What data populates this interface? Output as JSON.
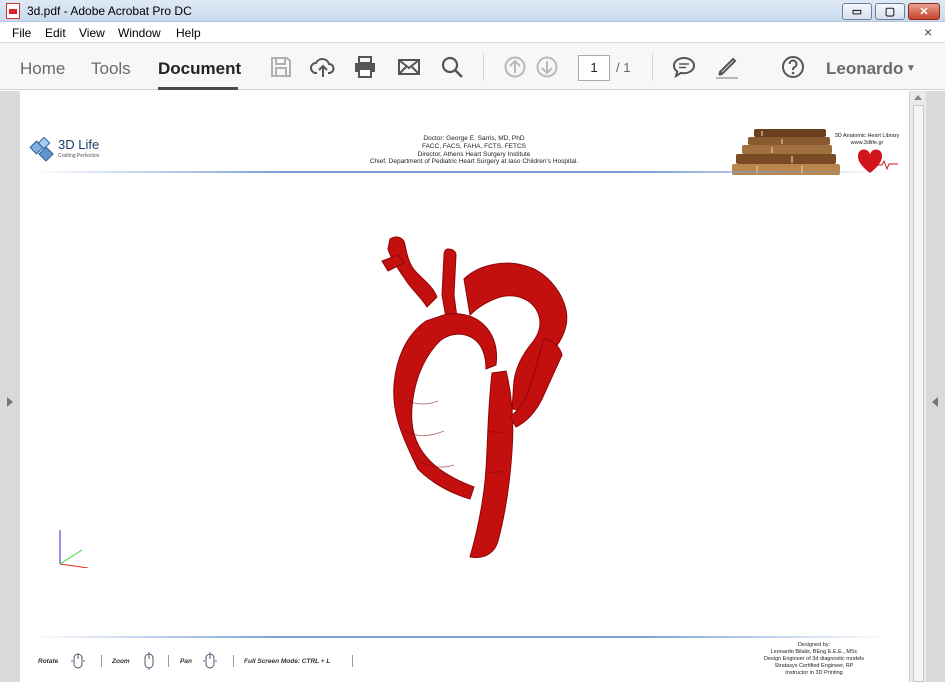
{
  "window": {
    "title": "3d.pdf - Adobe Acrobat Pro DC",
    "controls": {
      "minimize": "▭",
      "maximize": "▢",
      "close": "✕"
    }
  },
  "menu": {
    "items": [
      "File",
      "Edit",
      "View",
      "Window",
      "Help"
    ],
    "close_doc": "×"
  },
  "toolbar": {
    "tabs": [
      "Home",
      "Tools",
      "Document"
    ],
    "active_tab": "Document",
    "icons": [
      "save-icon",
      "upload-cloud-icon",
      "print-icon",
      "email-icon",
      "search-icon",
      "page-up-icon",
      "page-down-icon",
      "comment-icon",
      "highlight-pen-icon",
      "help-icon"
    ],
    "current_page": "1",
    "total_pages": "/ 1",
    "user": "Leonardo",
    "user_caret": "▼"
  },
  "document": {
    "logo_name": "3D Life",
    "logo_tagline": "Crafting Perfection",
    "doctor_lines": [
      "Doctor: George E. Sarris, MD, PhD",
      "FACC, FACS, FAHA, FCTS, FETCS",
      "Director, Athens Heart Surgery Institute",
      "Chief, Department of Pediatric Heart Surgery at Iaso Children's Hospital."
    ],
    "library_lines": [
      "3D Anatomic Heart Library",
      "www.3dlife.gr"
    ],
    "model_color": "#c40f0f",
    "footer_hints": [
      {
        "label": "Rotate"
      },
      {
        "label": "Zoom"
      },
      {
        "label": "Pan"
      },
      {
        "label": "Full Screen Mode:  CTRL + L"
      }
    ],
    "designer_lines": [
      "Designed by:",
      "Leonardo Bilalis, BEng E.E.E., MSc",
      "Design Engineer of 3d diagnostic models",
      "Stratasys Certified Engineer, RP",
      "Instructor in 3D Printing"
    ]
  }
}
